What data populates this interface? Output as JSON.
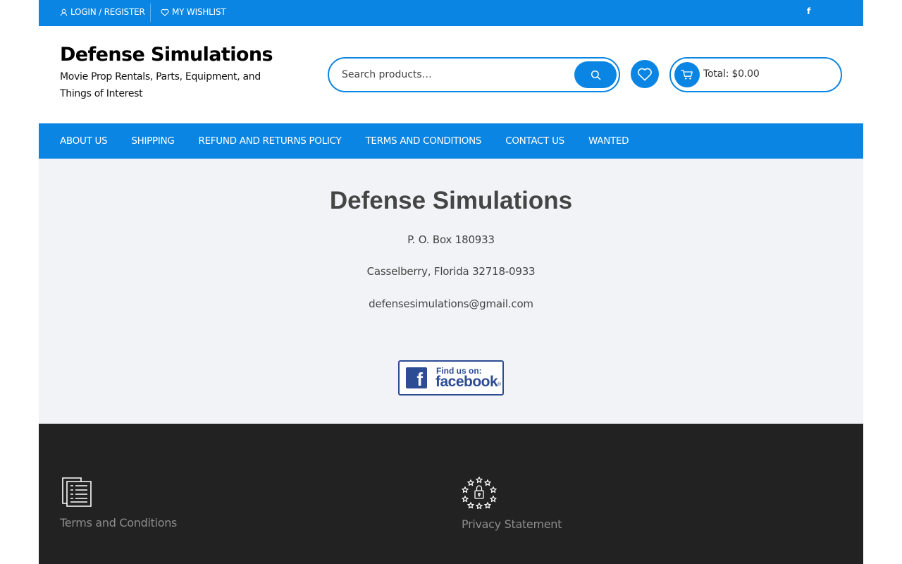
{
  "topbar": {
    "login_label": "LOGIN / REGISTER",
    "wishlist_label": "MY WISHLIST",
    "facebook_glyph": "f"
  },
  "header": {
    "site_title": "Defense Simulations",
    "tagline": "Movie Prop Rentals, Parts, Equipment, and Things of Interest",
    "search_placeholder": "Search products…",
    "cart_total": "Total: $0.00"
  },
  "nav": {
    "items": [
      {
        "label": "ABOUT US"
      },
      {
        "label": "SHIPPING"
      },
      {
        "label": "REFUND AND RETURNS POLICY"
      },
      {
        "label": "TERMS AND CONDITIONS"
      },
      {
        "label": "CONTACT US"
      },
      {
        "label": "WANTED"
      }
    ]
  },
  "content": {
    "heading": "Defense Simulations",
    "address_line1": "P. O. Box 180933",
    "address_line2": "Casselberry, Florida 32718-0933",
    "email": "defensesimulations@gmail.com",
    "facebook_badge": {
      "find_text": "Find us on:",
      "brand_text": "facebook",
      "reg_mark": "®",
      "logo_glyph": "f"
    }
  },
  "footer": {
    "items": [
      {
        "label": "Terms and Conditions",
        "icon": "document-icon"
      },
      {
        "label": "Privacy Statement",
        "icon": "privacy-lock-stars-icon"
      }
    ]
  },
  "colors": {
    "brand_blue": "#0a85e3",
    "content_bg": "#f2f3f7",
    "footer_bg": "#222222",
    "facebook_blue": "#2c4c93"
  }
}
